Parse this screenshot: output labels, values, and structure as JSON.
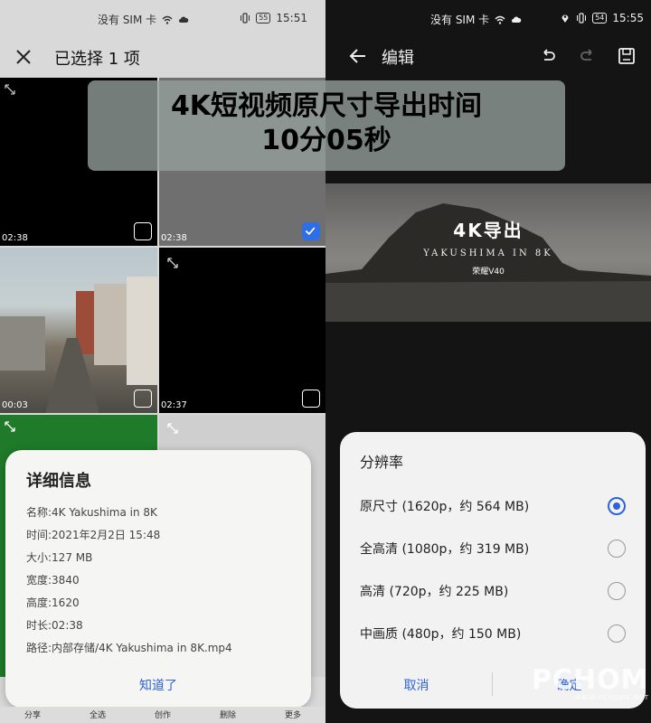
{
  "banner": {
    "line1": "4K短视频原尺寸导出时间",
    "line2": "10分05秒"
  },
  "left": {
    "status": {
      "carrier": "没有 SIM 卡",
      "battery": "55",
      "time": "15:51"
    },
    "header": {
      "title": "已选择 1 项"
    },
    "tiles": [
      {
        "duration": "02:38",
        "checked": false
      },
      {
        "duration": "02:38",
        "checked": true
      },
      {
        "duration": "00:03",
        "checked": false
      },
      {
        "duration": "02:37",
        "checked": false
      }
    ],
    "details": {
      "title": "详细信息",
      "rows": [
        {
          "label": "名称:",
          "value": "4K Yakushima in 8K"
        },
        {
          "label": "时间:",
          "value": "2021年2月2日 15:48"
        },
        {
          "label": "大小:",
          "value": "127 MB"
        },
        {
          "label": "宽度:",
          "value": "3840"
        },
        {
          "label": "高度:",
          "value": "1620"
        },
        {
          "label": "时长:",
          "value": "02:38"
        },
        {
          "label": "路径:",
          "value": "内部存储/4K Yakushima in 8K.mp4"
        }
      ],
      "ok_label": "知道了"
    },
    "bottom_bar": [
      "分享",
      "全选",
      "创作",
      "删除",
      "更多"
    ]
  },
  "right": {
    "status": {
      "carrier": "没有 SIM 卡",
      "battery": "54",
      "time": "15:55"
    },
    "header": {
      "title": "编辑"
    },
    "preview": {
      "title": "4K导出",
      "subtitle": "YAKUSHIMA IN 8K",
      "brand": "荣耀V40"
    },
    "resolution": {
      "title": "分辨率",
      "options": [
        {
          "label": "原尺寸 (1620p，约 564 MB)",
          "selected": true
        },
        {
          "label": "全高清 (1080p，约 319 MB)",
          "selected": false
        },
        {
          "label": "高清 (720p，约 225 MB)",
          "selected": false
        },
        {
          "label": "中画质 (480p，约 150 MB)",
          "selected": false
        }
      ],
      "cancel_label": "取消",
      "confirm_label": "确定"
    }
  },
  "watermark": {
    "main": "PCHOME",
    "sub": "WWW.PCHOME.NET"
  },
  "colors": {
    "accent": "#2e63d8",
    "check": "#2e6fe8"
  }
}
